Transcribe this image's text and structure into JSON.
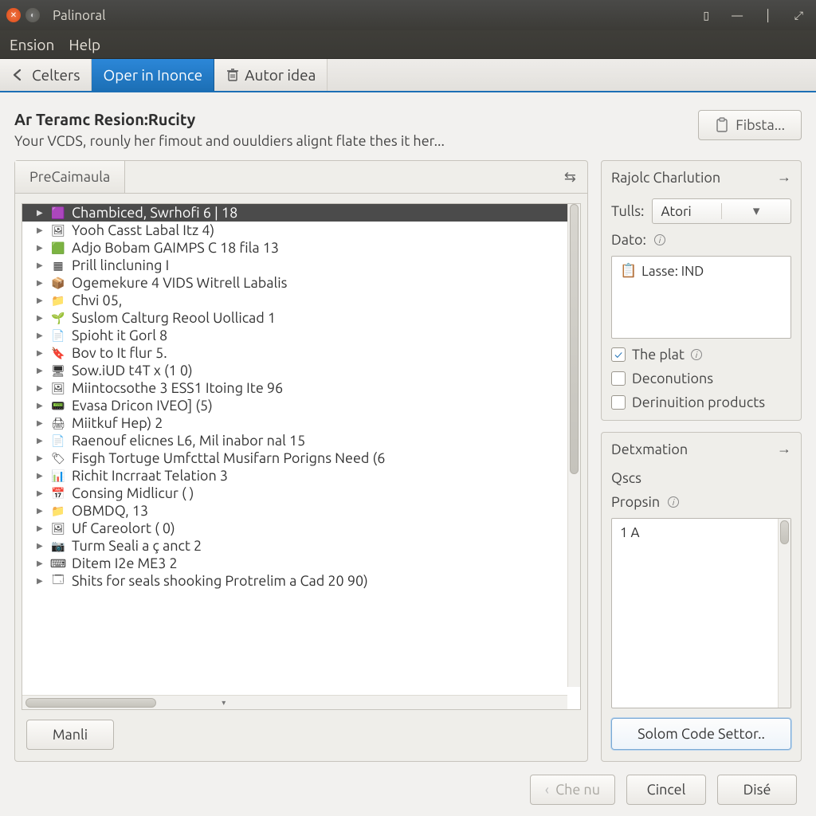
{
  "window": {
    "title": "Palinoral"
  },
  "menubar": {
    "items": [
      "Ension",
      "Help"
    ]
  },
  "toolbar": {
    "celters": "Celters",
    "open_in_inonce": "Oper in Inonce",
    "autor_idea": "Autor idea"
  },
  "header": {
    "title": "Ar Teramc Resion:Rucity",
    "subtitle": "Your VCDS, rounly her fimout and ouuldiers alignt flate thes it her...",
    "fibsta": "Fibsta..."
  },
  "left": {
    "tab": "PreCaimaula",
    "manli": "Manli",
    "items": [
      {
        "icon": "img-purple",
        "label": "Chambiced, Swrhofi 6 | 18",
        "selected": true
      },
      {
        "icon": "img-photo",
        "label": "Yooh Casst Labal Itz 4)"
      },
      {
        "icon": "img-green",
        "label": "Adjo Bobam GAIMPS C 18 fila 13"
      },
      {
        "icon": "grid",
        "label": "Prill lincluning I"
      },
      {
        "icon": "cube",
        "label": "Ogemekure 4 VIDS Witrell Labalis"
      },
      {
        "icon": "folder",
        "label": "Chvi 05,"
      },
      {
        "icon": "plant",
        "label": "Suslom Calturg Reool Uollicad 1"
      },
      {
        "icon": "doc",
        "label": "Spioht it Gorl 8"
      },
      {
        "icon": "tag-red",
        "label": "Bov to It flur 5."
      },
      {
        "icon": "monitor",
        "label": "Sow.iUD t4T x (1 0)"
      },
      {
        "icon": "img-photo",
        "label": "Miintocsothe 3 ESS1 Itoing Ite 96"
      },
      {
        "icon": "device",
        "label": "Evasa Dricon IVEO] (5)"
      },
      {
        "icon": "printer",
        "label": "Miitkuf Hep) 2"
      },
      {
        "icon": "doc",
        "label": "Raenouf elicnes L6, Mil inabor nal 15"
      },
      {
        "icon": "badge",
        "label": "Fisgh Tortuge Umfcttal Musifarn Porigns Need (6"
      },
      {
        "icon": "chart",
        "label": "Richit Incrraat Telation 3"
      },
      {
        "icon": "calendar",
        "label": "Consing Midlicur ( )"
      },
      {
        "icon": "folder",
        "label": "OBMDQ, 13"
      },
      {
        "icon": "img-photo",
        "label": "Uf Careolort ( 0)"
      },
      {
        "icon": "camera",
        "label": "Turm Seali a ç anct 2"
      },
      {
        "icon": "terminal",
        "label": "Ditem I2e ME3 2"
      },
      {
        "icon": "window",
        "label": "Shits for seals shooking Protrelim a Cad 20 90)"
      }
    ]
  },
  "right1": {
    "title": "Rajolc Charlution",
    "tulls_label": "Tulls:",
    "tulls_value": "Atori",
    "dato_label": "Dato:",
    "lasse_value": "Lasse: IND",
    "chk1": "The plat",
    "chk2": "Deconutions",
    "chk3": "Derinuition products"
  },
  "right2": {
    "title": "Detxmation",
    "oscs": "Qscs",
    "propsin": "Propsin",
    "content": "1 A",
    "button": "Solom Code Settor.."
  },
  "footer": {
    "che": "Che nu",
    "cincel": "Cincel",
    "dise": "Disé"
  },
  "icons": {
    "img-purple": "🟪",
    "img-photo": "🖼",
    "img-green": "🟩",
    "grid": "▦",
    "cube": "📦",
    "folder": "📁",
    "plant": "🌱",
    "doc": "📄",
    "tag-red": "🔖",
    "monitor": "🖥",
    "device": "📟",
    "printer": "🖨",
    "badge": "🏷",
    "chart": "📊",
    "calendar": "📅",
    "camera": "📷",
    "terminal": "⌨",
    "window": "🗔",
    "file": "📋"
  }
}
